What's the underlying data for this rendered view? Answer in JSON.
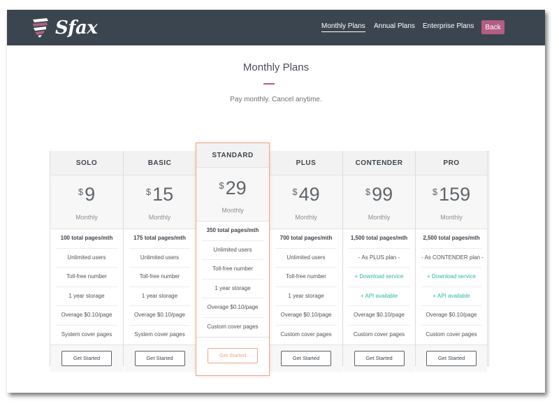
{
  "brand": {
    "name": "Sfax",
    "logo_icon": "shield-stripes-icon",
    "accent": "#b35d85"
  },
  "nav": {
    "links": [
      {
        "label": "Monthly Plans",
        "active": true
      },
      {
        "label": "Annual Plans",
        "active": false
      },
      {
        "label": "Enterprise Plans",
        "active": false
      }
    ],
    "back_label": "Back"
  },
  "page": {
    "title": "Monthly Plans",
    "subtitle": "Pay monthly. Cancel anytime."
  },
  "plans": [
    {
      "name": "SOLO",
      "currency": "$",
      "price": "9",
      "period": "Monthly",
      "features": [
        "100 total pages/mth",
        "Unlimited users",
        "Toll-free number",
        "1 year storage",
        "Overage $0.10/page",
        "System cover pages"
      ],
      "cta": "Get Started"
    },
    {
      "name": "BASIC",
      "currency": "$",
      "price": "15",
      "period": "Monthly",
      "features": [
        "175 total pages/mth",
        "Unlimited users",
        "Toll-free number",
        "1 year storage",
        "Overage $0.10/page",
        "System cover pages"
      ],
      "cta": "Get Started"
    },
    {
      "name": "STANDARD",
      "currency": "$",
      "price": "29",
      "period": "Monthly",
      "features": [
        "350 total pages/mth",
        "Unlimited users",
        "Toll-free number",
        "1 year storage",
        "Overage $0.10/page",
        "Custom cover pages"
      ],
      "cta": "Get Started",
      "featured": true
    },
    {
      "name": "PLUS",
      "currency": "$",
      "price": "49",
      "period": "Monthly",
      "features": [
        "700 total pages/mth",
        "Unlimited users",
        "Toll-free number",
        "1 year storage",
        "Overage $0.10/page",
        "Custom cover pages"
      ],
      "cta": "Get Started"
    },
    {
      "name": "CONTENDER",
      "currency": "$",
      "price": "99",
      "period": "Monthly",
      "features": [
        "1,500 total pages/mth",
        "- As PLUS plan -",
        "+ Download service",
        "+ API available",
        "Overage $0.10/page",
        "Custom cover pages"
      ],
      "cta": "Get Started"
    },
    {
      "name": "PRO",
      "currency": "$",
      "price": "159",
      "period": "Monthly",
      "features": [
        "2,500 total pages/mth",
        "- As CONTENDER plan -",
        "+ Download service",
        "+ API available",
        "Overage $0.10/page",
        "Custom cover pages"
      ],
      "cta": "Get Started"
    }
  ]
}
